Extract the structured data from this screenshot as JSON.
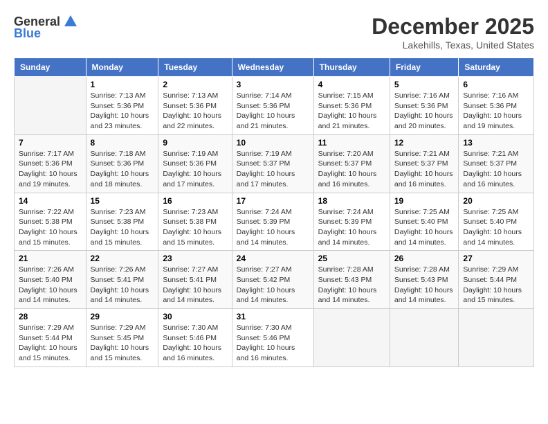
{
  "header": {
    "logo_general": "General",
    "logo_blue": "Blue",
    "month_title": "December 2025",
    "location": "Lakehills, Texas, United States"
  },
  "days_of_week": [
    "Sunday",
    "Monday",
    "Tuesday",
    "Wednesday",
    "Thursday",
    "Friday",
    "Saturday"
  ],
  "weeks": [
    [
      {
        "day": "",
        "sunrise": "",
        "sunset": "",
        "daylight": ""
      },
      {
        "day": "1",
        "sunrise": "Sunrise: 7:13 AM",
        "sunset": "Sunset: 5:36 PM",
        "daylight": "Daylight: 10 hours and 23 minutes."
      },
      {
        "day": "2",
        "sunrise": "Sunrise: 7:13 AM",
        "sunset": "Sunset: 5:36 PM",
        "daylight": "Daylight: 10 hours and 22 minutes."
      },
      {
        "day": "3",
        "sunrise": "Sunrise: 7:14 AM",
        "sunset": "Sunset: 5:36 PM",
        "daylight": "Daylight: 10 hours and 21 minutes."
      },
      {
        "day": "4",
        "sunrise": "Sunrise: 7:15 AM",
        "sunset": "Sunset: 5:36 PM",
        "daylight": "Daylight: 10 hours and 21 minutes."
      },
      {
        "day": "5",
        "sunrise": "Sunrise: 7:16 AM",
        "sunset": "Sunset: 5:36 PM",
        "daylight": "Daylight: 10 hours and 20 minutes."
      },
      {
        "day": "6",
        "sunrise": "Sunrise: 7:16 AM",
        "sunset": "Sunset: 5:36 PM",
        "daylight": "Daylight: 10 hours and 19 minutes."
      }
    ],
    [
      {
        "day": "7",
        "sunrise": "Sunrise: 7:17 AM",
        "sunset": "Sunset: 5:36 PM",
        "daylight": "Daylight: 10 hours and 19 minutes."
      },
      {
        "day": "8",
        "sunrise": "Sunrise: 7:18 AM",
        "sunset": "Sunset: 5:36 PM",
        "daylight": "Daylight: 10 hours and 18 minutes."
      },
      {
        "day": "9",
        "sunrise": "Sunrise: 7:19 AM",
        "sunset": "Sunset: 5:36 PM",
        "daylight": "Daylight: 10 hours and 17 minutes."
      },
      {
        "day": "10",
        "sunrise": "Sunrise: 7:19 AM",
        "sunset": "Sunset: 5:37 PM",
        "daylight": "Daylight: 10 hours and 17 minutes."
      },
      {
        "day": "11",
        "sunrise": "Sunrise: 7:20 AM",
        "sunset": "Sunset: 5:37 PM",
        "daylight": "Daylight: 10 hours and 16 minutes."
      },
      {
        "day": "12",
        "sunrise": "Sunrise: 7:21 AM",
        "sunset": "Sunset: 5:37 PM",
        "daylight": "Daylight: 10 hours and 16 minutes."
      },
      {
        "day": "13",
        "sunrise": "Sunrise: 7:21 AM",
        "sunset": "Sunset: 5:37 PM",
        "daylight": "Daylight: 10 hours and 16 minutes."
      }
    ],
    [
      {
        "day": "14",
        "sunrise": "Sunrise: 7:22 AM",
        "sunset": "Sunset: 5:38 PM",
        "daylight": "Daylight: 10 hours and 15 minutes."
      },
      {
        "day": "15",
        "sunrise": "Sunrise: 7:23 AM",
        "sunset": "Sunset: 5:38 PM",
        "daylight": "Daylight: 10 hours and 15 minutes."
      },
      {
        "day": "16",
        "sunrise": "Sunrise: 7:23 AM",
        "sunset": "Sunset: 5:38 PM",
        "daylight": "Daylight: 10 hours and 15 minutes."
      },
      {
        "day": "17",
        "sunrise": "Sunrise: 7:24 AM",
        "sunset": "Sunset: 5:39 PM",
        "daylight": "Daylight: 10 hours and 14 minutes."
      },
      {
        "day": "18",
        "sunrise": "Sunrise: 7:24 AM",
        "sunset": "Sunset: 5:39 PM",
        "daylight": "Daylight: 10 hours and 14 minutes."
      },
      {
        "day": "19",
        "sunrise": "Sunrise: 7:25 AM",
        "sunset": "Sunset: 5:40 PM",
        "daylight": "Daylight: 10 hours and 14 minutes."
      },
      {
        "day": "20",
        "sunrise": "Sunrise: 7:25 AM",
        "sunset": "Sunset: 5:40 PM",
        "daylight": "Daylight: 10 hours and 14 minutes."
      }
    ],
    [
      {
        "day": "21",
        "sunrise": "Sunrise: 7:26 AM",
        "sunset": "Sunset: 5:40 PM",
        "daylight": "Daylight: 10 hours and 14 minutes."
      },
      {
        "day": "22",
        "sunrise": "Sunrise: 7:26 AM",
        "sunset": "Sunset: 5:41 PM",
        "daylight": "Daylight: 10 hours and 14 minutes."
      },
      {
        "day": "23",
        "sunrise": "Sunrise: 7:27 AM",
        "sunset": "Sunset: 5:41 PM",
        "daylight": "Daylight: 10 hours and 14 minutes."
      },
      {
        "day": "24",
        "sunrise": "Sunrise: 7:27 AM",
        "sunset": "Sunset: 5:42 PM",
        "daylight": "Daylight: 10 hours and 14 minutes."
      },
      {
        "day": "25",
        "sunrise": "Sunrise: 7:28 AM",
        "sunset": "Sunset: 5:43 PM",
        "daylight": "Daylight: 10 hours and 14 minutes."
      },
      {
        "day": "26",
        "sunrise": "Sunrise: 7:28 AM",
        "sunset": "Sunset: 5:43 PM",
        "daylight": "Daylight: 10 hours and 14 minutes."
      },
      {
        "day": "27",
        "sunrise": "Sunrise: 7:29 AM",
        "sunset": "Sunset: 5:44 PM",
        "daylight": "Daylight: 10 hours and 15 minutes."
      }
    ],
    [
      {
        "day": "28",
        "sunrise": "Sunrise: 7:29 AM",
        "sunset": "Sunset: 5:44 PM",
        "daylight": "Daylight: 10 hours and 15 minutes."
      },
      {
        "day": "29",
        "sunrise": "Sunrise: 7:29 AM",
        "sunset": "Sunset: 5:45 PM",
        "daylight": "Daylight: 10 hours and 15 minutes."
      },
      {
        "day": "30",
        "sunrise": "Sunrise: 7:30 AM",
        "sunset": "Sunset: 5:46 PM",
        "daylight": "Daylight: 10 hours and 16 minutes."
      },
      {
        "day": "31",
        "sunrise": "Sunrise: 7:30 AM",
        "sunset": "Sunset: 5:46 PM",
        "daylight": "Daylight: 10 hours and 16 minutes."
      },
      {
        "day": "",
        "sunrise": "",
        "sunset": "",
        "daylight": ""
      },
      {
        "day": "",
        "sunrise": "",
        "sunset": "",
        "daylight": ""
      },
      {
        "day": "",
        "sunrise": "",
        "sunset": "",
        "daylight": ""
      }
    ]
  ]
}
